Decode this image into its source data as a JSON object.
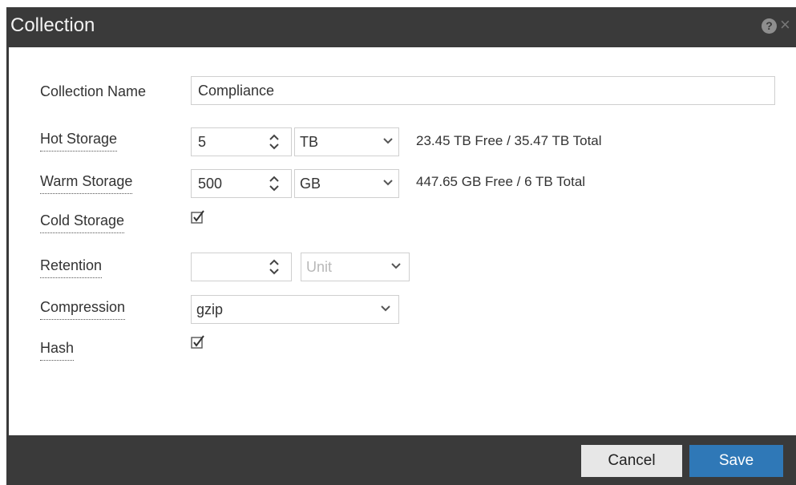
{
  "dialog": {
    "title": "Collection",
    "help_icon": "question-circle-icon",
    "close_icon": "close-icon"
  },
  "form": {
    "collection_name": {
      "label": "Collection Name",
      "value": "Compliance"
    },
    "hot_storage": {
      "label": "Hot Storage",
      "value": "5",
      "unit": "TB",
      "info": "23.45 TB Free / 35.47 TB Total"
    },
    "warm_storage": {
      "label": "Warm Storage",
      "value": "500",
      "unit": "GB",
      "info": "447.65 GB Free / 6 TB Total"
    },
    "cold_storage": {
      "label": "Cold Storage",
      "checked": true
    },
    "retention": {
      "label": "Retention",
      "value": "",
      "unit_placeholder": "Unit"
    },
    "compression": {
      "label": "Compression",
      "value": "gzip"
    },
    "hash": {
      "label": "Hash",
      "checked": true
    }
  },
  "footer": {
    "cancel_label": "Cancel",
    "save_label": "Save"
  },
  "colors": {
    "titlebar": "#3a3a3a",
    "save_button": "#2f78b7",
    "cancel_button": "#e7e7e7"
  }
}
